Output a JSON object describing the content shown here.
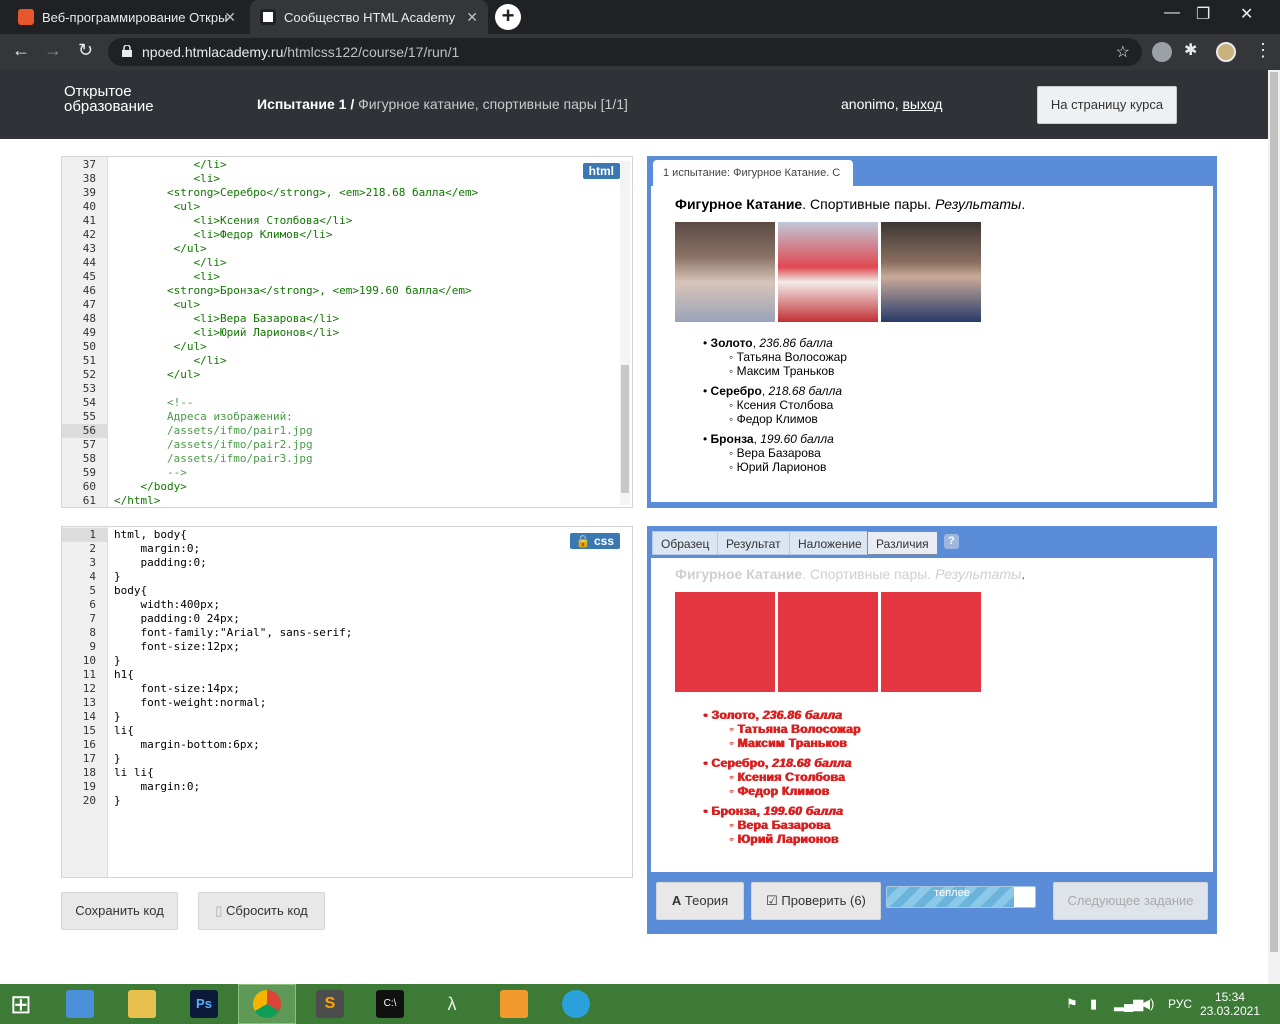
{
  "browser": {
    "tabs": [
      {
        "title": "Веб-программирование Откры",
        "active": false
      },
      {
        "title": "Сообщество HTML Academy",
        "active": true
      }
    ],
    "url_host": "npoed.htmlacademy.ru",
    "url_path": "/htmlcss122/course/17/run/1"
  },
  "header": {
    "logo_line1": "Открытое",
    "logo_line2": "образование",
    "challenge_label": "Испытание 1 /",
    "challenge_title": "Фигурное катание, спортивные пары [1/1]",
    "user": "anonimo,",
    "logout": "выход",
    "course_button": "На страницу курса"
  },
  "html_editor": {
    "label": "html",
    "lines": [
      {
        "n": "37",
        "t": "            </li>"
      },
      {
        "n": "38",
        "t": "            <li>"
      },
      {
        "n": "39",
        "t": "        <strong>Серебро</strong>, <em>218.68 балла</em>"
      },
      {
        "n": "40",
        "t": "         <ul>"
      },
      {
        "n": "41",
        "t": "            <li>Ксения Столбова</li>"
      },
      {
        "n": "42",
        "t": "            <li>Федор Климов</li>"
      },
      {
        "n": "43",
        "t": "         </ul>"
      },
      {
        "n": "44",
        "t": "            </li>"
      },
      {
        "n": "45",
        "t": "            <li>"
      },
      {
        "n": "46",
        "t": "        <strong>Бронза</strong>, <em>199.60 балла</em>"
      },
      {
        "n": "47",
        "t": "         <ul>"
      },
      {
        "n": "48",
        "t": "            <li>Вера Базарова</li>"
      },
      {
        "n": "49",
        "t": "            <li>Юрий Ларионов</li>"
      },
      {
        "n": "50",
        "t": "         </ul>"
      },
      {
        "n": "51",
        "t": "            </li>"
      },
      {
        "n": "52",
        "t": "        </ul>"
      },
      {
        "n": "53",
        "t": ""
      },
      {
        "n": "54",
        "t": "        <!--"
      },
      {
        "n": "55",
        "t": "        Адреса изображений:"
      },
      {
        "n": "56",
        "t": "        /assets/ifmo/pair1.jpg"
      },
      {
        "n": "57",
        "t": "        /assets/ifmo/pair2.jpg"
      },
      {
        "n": "58",
        "t": "        /assets/ifmo/pair3.jpg"
      },
      {
        "n": "59",
        "t": "        -->"
      },
      {
        "n": "60",
        "t": "    </body>"
      },
      {
        "n": "61",
        "t": "</html>"
      }
    ]
  },
  "css_editor": {
    "label": "css",
    "lines": [
      {
        "n": "1",
        "t": "html, body{"
      },
      {
        "n": "2",
        "t": "    margin:0;"
      },
      {
        "n": "3",
        "t": "    padding:0;"
      },
      {
        "n": "4",
        "t": "}"
      },
      {
        "n": "5",
        "t": "body{"
      },
      {
        "n": "6",
        "t": "    width:400px;"
      },
      {
        "n": "7",
        "t": "    padding:0 24px;"
      },
      {
        "n": "8",
        "t": "    font-family:\"Arial\", sans-serif;"
      },
      {
        "n": "9",
        "t": "    font-size:12px;"
      },
      {
        "n": "10",
        "t": "}"
      },
      {
        "n": "11",
        "t": "h1{"
      },
      {
        "n": "12",
        "t": "    font-size:14px;"
      },
      {
        "n": "13",
        "t": "    font-weight:normal;"
      },
      {
        "n": "14",
        "t": "}"
      },
      {
        "n": "15",
        "t": "li{"
      },
      {
        "n": "16",
        "t": "    margin-bottom:6px;"
      },
      {
        "n": "17",
        "t": "}"
      },
      {
        "n": "18",
        "t": "li li{"
      },
      {
        "n": "19",
        "t": "    margin:0;"
      },
      {
        "n": "20",
        "t": "}"
      }
    ]
  },
  "buttons": {
    "save": "Сохранить код",
    "reset": "Сбросить код",
    "theory": "Теория",
    "check": "Проверить (6)",
    "next": "Следующее задание",
    "progress_label": "теплее",
    "progress_value": 0.86
  },
  "preview": {
    "tab_title": "1 испытание: Фигурное Катание. С",
    "heading_bold": "Фигурное Катание",
    "heading_plain": ". Спортивные пары.",
    "heading_italic": "Результаты",
    "heading_end": ".",
    "medals": [
      {
        "medal": "Золото",
        "score": "236.86 балла",
        "athletes": [
          "Татьяна Волосожар",
          "Максим Траньков"
        ]
      },
      {
        "medal": "Серебро",
        "score": "218.68 балла",
        "athletes": [
          "Ксения Столбова",
          "Федор Климов"
        ]
      },
      {
        "medal": "Бронза",
        "score": "199.60 балла",
        "athletes": [
          "Вера Базарова",
          "Юрий Ларионов"
        ]
      }
    ]
  },
  "compare_tabs": [
    "Образец",
    "Результат",
    "Наложение",
    "Различия"
  ],
  "compare_help": "?",
  "taskbar": {
    "lang": "РУС",
    "time": "15:34",
    "date": "23.03.2021"
  }
}
